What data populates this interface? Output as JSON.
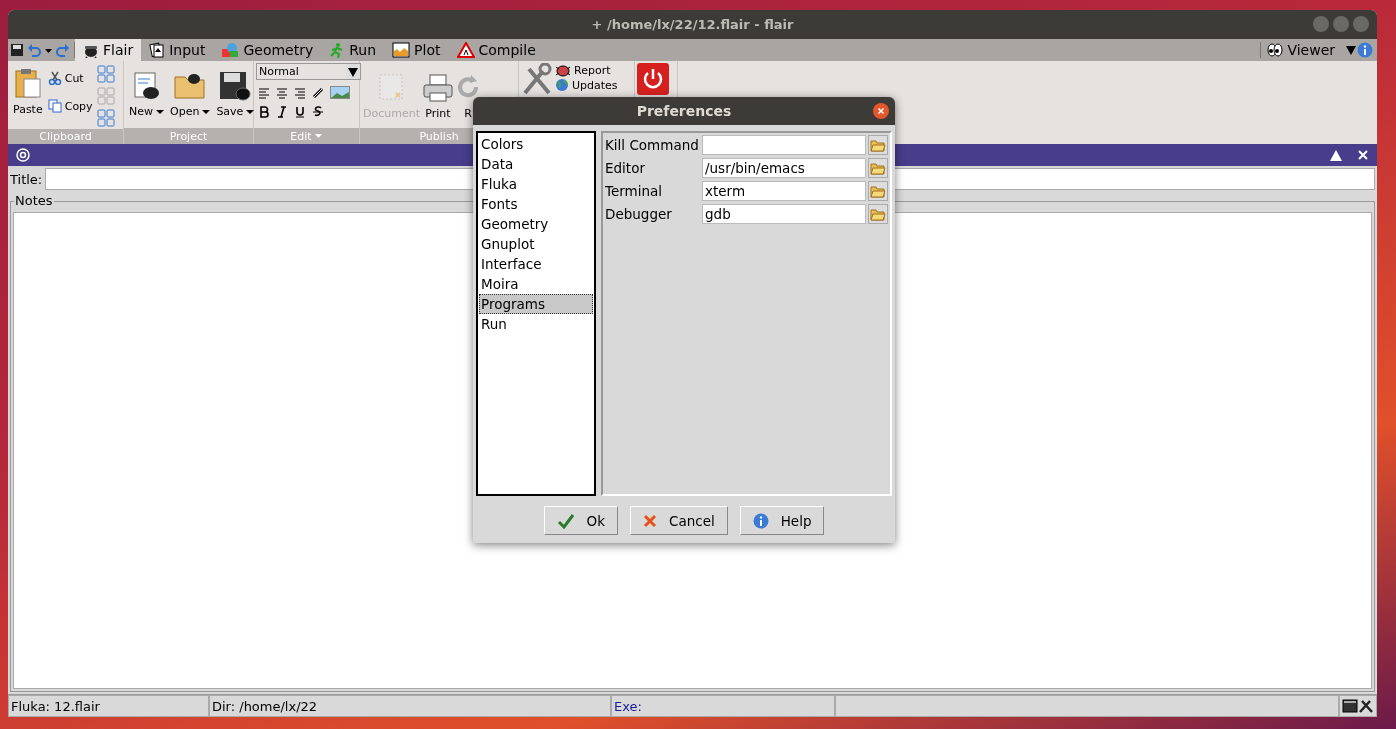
{
  "window": {
    "title": "+ /home/lx/22/12.flair - flair"
  },
  "tabs": [
    {
      "label": "Flair",
      "selected": true,
      "kind": "flair"
    },
    {
      "label": "Input",
      "selected": false,
      "kind": "input"
    },
    {
      "label": "Geometry",
      "selected": false,
      "kind": "geometry"
    },
    {
      "label": "Run",
      "selected": false,
      "kind": "run"
    },
    {
      "label": "Plot",
      "selected": false,
      "kind": "plot"
    },
    {
      "label": "Compile",
      "selected": false,
      "kind": "compile"
    }
  ],
  "viewer": {
    "label": "Viewer"
  },
  "ribbon": {
    "clipboard": {
      "label": "Clipboard",
      "paste": "Paste",
      "cut": "Cut",
      "copy": "Copy"
    },
    "project": {
      "label": "Project",
      "buttons": [
        "New",
        "Open",
        "Save"
      ]
    },
    "edit": {
      "label": "Edit",
      "style": "Normal"
    },
    "publish": {
      "label": "Publish",
      "buttons": [
        {
          "label": "Document",
          "disabled": true,
          "kind": "document"
        },
        {
          "label": "Print",
          "disabled": false,
          "kind": "print"
        },
        {
          "label": "R",
          "disabled": false,
          "kind": "refresh"
        }
      ]
    },
    "tools": {
      "report": "Report",
      "updates": "Updates"
    }
  },
  "title_field": {
    "label": "Title:"
  },
  "notes": {
    "label": "Notes"
  },
  "status_bar": [
    "Fluka: 12.flair",
    "Dir: /home/lx/22",
    "Exe:"
  ],
  "dialog": {
    "title": "Preferences",
    "categories": [
      {
        "label": "Colors",
        "selected": false
      },
      {
        "label": "Data",
        "selected": false
      },
      {
        "label": "Fluka",
        "selected": false
      },
      {
        "label": "Fonts",
        "selected": false
      },
      {
        "label": "Geometry",
        "selected": false
      },
      {
        "label": "Gnuplot",
        "selected": false
      },
      {
        "label": "Interface",
        "selected": false
      },
      {
        "label": "Moira",
        "selected": false
      },
      {
        "label": "Programs",
        "selected": true
      },
      {
        "label": "Run",
        "selected": false
      }
    ],
    "fields": [
      {
        "label": "Kill Command"
      },
      {
        "label": "Editor",
        "value": "/usr/bin/emacs"
      },
      {
        "label": "Terminal",
        "value": "xterm"
      },
      {
        "label": "Debugger",
        "value": "gdb"
      }
    ],
    "buttons": [
      {
        "label": "Ok",
        "kind": "ok"
      },
      {
        "label": "Cancel",
        "kind": "cancel"
      },
      {
        "label": "Help",
        "kind": "help"
      }
    ]
  }
}
